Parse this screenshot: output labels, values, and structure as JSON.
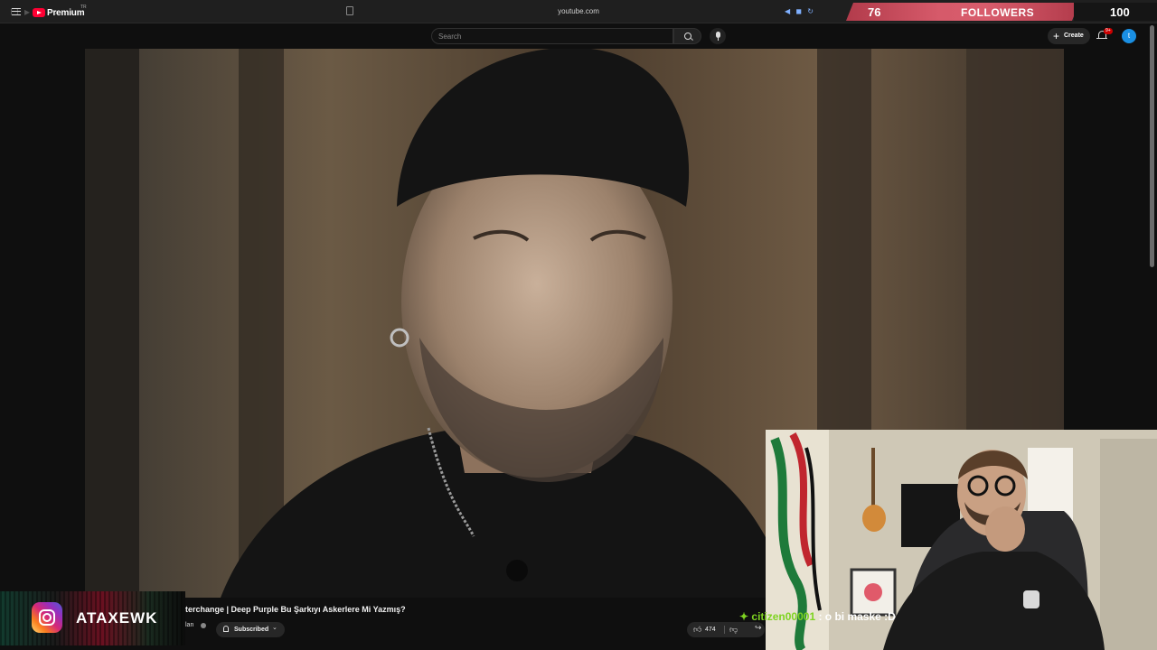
{
  "browser": {
    "url": "youtube.com"
  },
  "followers_overlay": {
    "current": "76",
    "label": "FOLLOWERS",
    "goal": "100"
  },
  "yt_header": {
    "brand": "Premium",
    "country": "TR",
    "search_placeholder": "Search",
    "create_label": "Create",
    "notification_count": "9+",
    "avatar_letter": "t"
  },
  "video": {
    "title": "terchange | Deep Purple Bu Şarkıyı Askerlere Mi Yazmış?",
    "channel": "lan",
    "subscribe_label": "Subscribed",
    "like_count": "474"
  },
  "instagram_overlay": {
    "handle": "ATAXEWK"
  },
  "chat": {
    "username": "citizen00001",
    "message": " : o bi maske :D"
  },
  "colors": {
    "youtube_red": "#ff0033",
    "followers_band": "#d65a6a",
    "chat_user": "#7ed321",
    "avatar_blue": "#1a8fe3"
  }
}
